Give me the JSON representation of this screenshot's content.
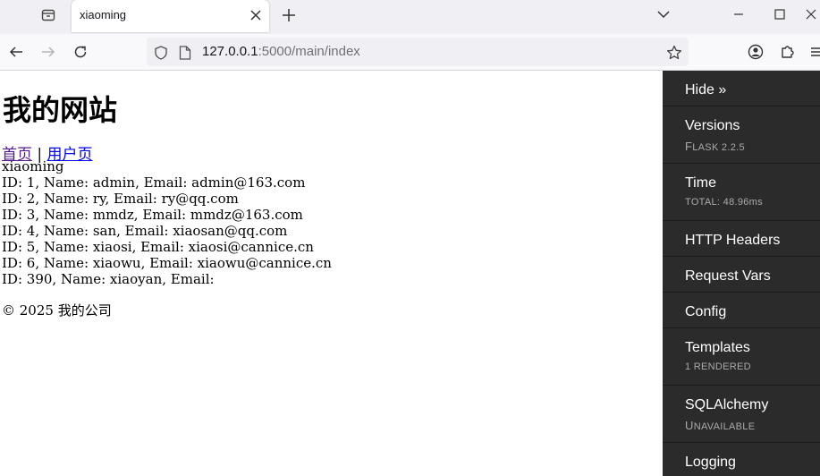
{
  "browser": {
    "tab_title": "xiaoming",
    "url_host": "127.0.0.1",
    "url_path": ":5000/main/index"
  },
  "page": {
    "site_title": "我的网站",
    "nav": {
      "home": "首页",
      "separator": "|",
      "user": "用户页"
    },
    "username": "xiaoming",
    "users": [
      "ID: 1, Name: admin, Email: admin@163.com",
      "ID: 2, Name: ry, Email: ry@qq.com",
      "ID: 3, Name: mmdz, Email: mmdz@163.com",
      "ID: 4, Name: san, Email: xiaosan@qq.com",
      "ID: 5, Name: xiaosi, Email: xiaosi@cannice.cn",
      "ID: 6, Name: xiaowu, Email: xiaowu@cannice.cn",
      "ID: 390, Name: xiaoyan, Email:"
    ],
    "footer": "© 2025 我的公司"
  },
  "debug_toolbar": {
    "hide": "Hide »",
    "versions": {
      "title": "Versions",
      "sub_first": "F",
      "sub_rest": "lask 2.2.5"
    },
    "time": {
      "title": "Time",
      "sub": "TOTAL: 48.96ms"
    },
    "http_headers": {
      "title": "HTTP Headers"
    },
    "request_vars": {
      "title": "Request Vars"
    },
    "config": {
      "title": "Config"
    },
    "templates": {
      "title": "Templates",
      "sub": "1 RENDERED"
    },
    "sqlalchemy": {
      "title": "SQLAlchemy",
      "sub_first": "U",
      "sub_rest": "navailable"
    },
    "logging": {
      "title": "Logging"
    }
  },
  "colors": {
    "debug_bg": "#2b2b2b",
    "link": "#0000ee",
    "visited_link": "#551a8b",
    "tab_strip": "#f0f0f4"
  }
}
